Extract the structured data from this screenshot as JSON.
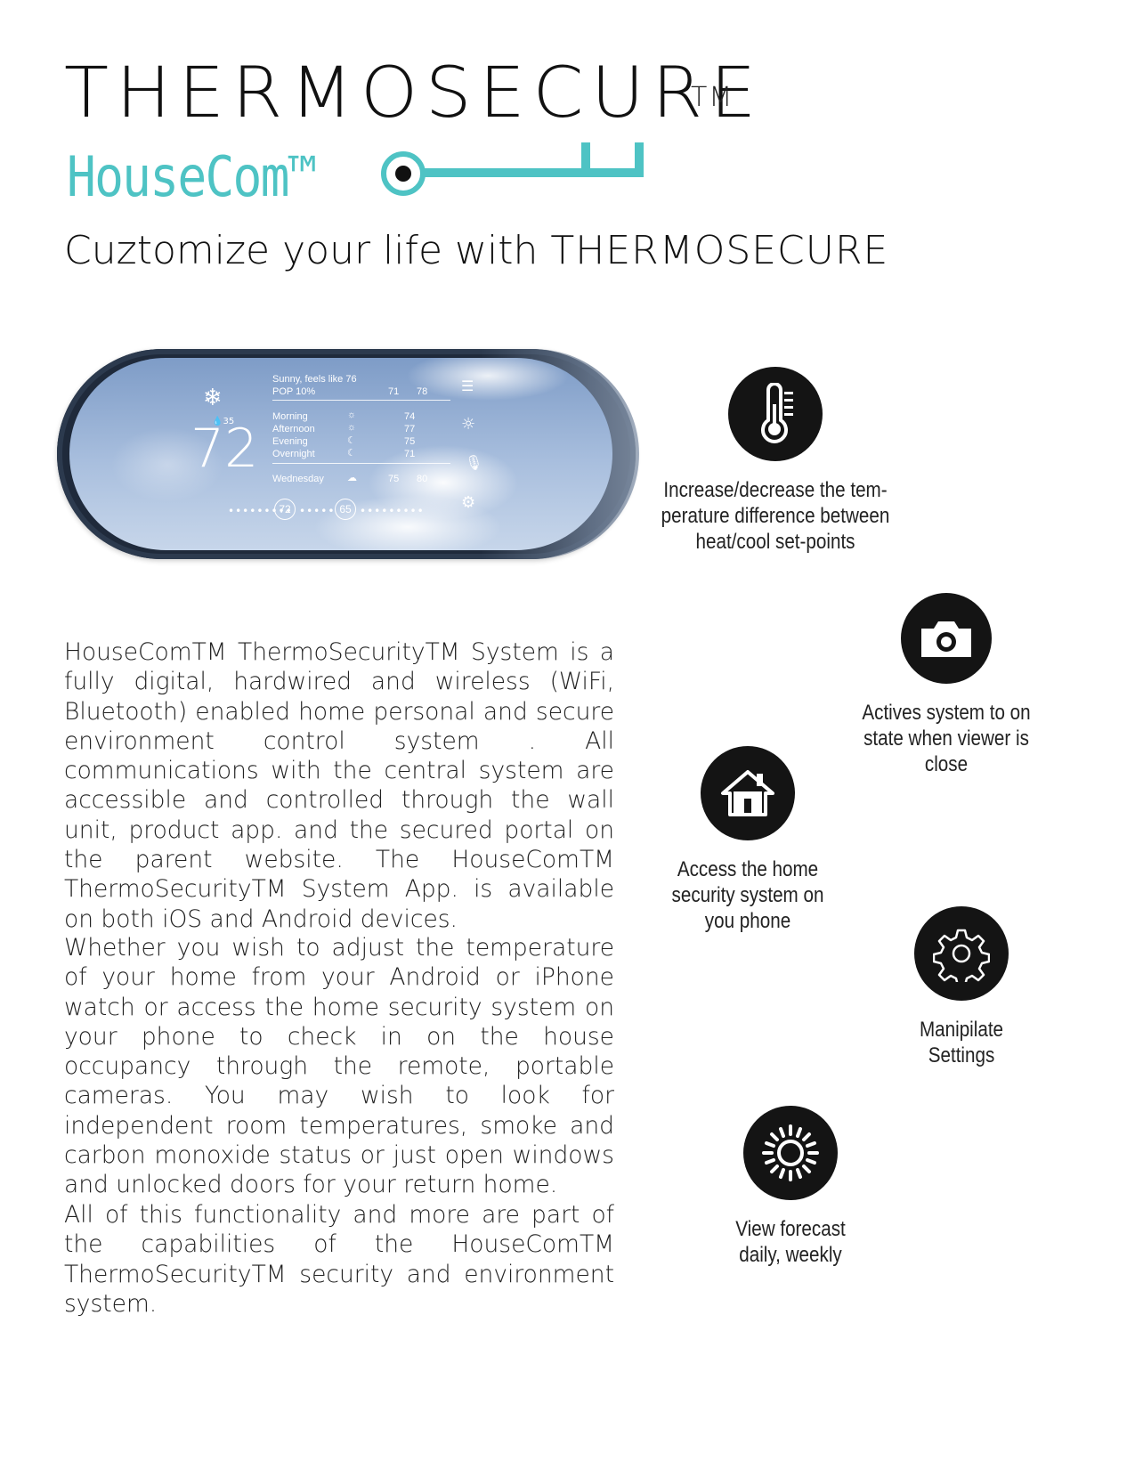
{
  "header": {
    "brand": "THERMOSECURE",
    "brand_tm": "TM",
    "product": "HouseCom™",
    "tagline_prefix": "Cuztomize your life with",
    "tagline_brand": "THERMOSECURE",
    "accent_color": "#4ec3c4"
  },
  "thermostat": {
    "current_temp": "72",
    "humidity": "35",
    "condition": "Sunny, feels like 76",
    "pop": "POP 10%",
    "today_low": "71",
    "today_high": "78",
    "periods": [
      {
        "name": "Morning",
        "temp": "74",
        "icon": "sun-icon"
      },
      {
        "name": "Afternoon",
        "temp": "77",
        "icon": "sun-icon"
      },
      {
        "name": "Evening",
        "temp": "75",
        "icon": "moon-icon"
      },
      {
        "name": "Overnight",
        "temp": "71",
        "icon": "moon-icon"
      }
    ],
    "next_day": {
      "name": "Wednesday",
      "low": "75",
      "high": "80",
      "icon": "cloud-icon"
    },
    "heat_setpoint": "72",
    "cool_setpoint": "65"
  },
  "body": {
    "paragraphs": [
      "HouseComTM ThermoSecurityTM System is a fully digital, hardwired and wireless (WiFi, Blue­tooth) enabled home personal and secure envi­ronment control system . All communications with the central system are accessible and con­trolled through the wall unit, product app. and the secured portal on the parent website. The HouseComTM ThermoSecurityTM System App. is available on both iOS and Android devices.",
      "Whether you wish to adjust the temperature of your home from your Android or iPhone watch or access the home security system on your phone to check in on the house occupancy through the remote, portable cameras. You may wish to look for independent room temperatures, smoke and carbon monoxide status or just open windows and unlocked doors for your return home.",
      "All of this functionality and more are part of the capabilities of the HouseComTM ThermoSecuri­tyTM security and environment system."
    ]
  },
  "features": [
    {
      "icon": "thermometer-icon",
      "label": "Increase/decrease the tem-\nperature difference between\nheat/cool set-points"
    },
    {
      "icon": "camera-icon",
      "label": "Actives system to on\nstate when viewer is\nclose"
    },
    {
      "icon": "home-icon",
      "label": "Access the home\nsecurity system on\nyou phone"
    },
    {
      "icon": "gear-icon",
      "label": "Manipilate\nSettings"
    },
    {
      "icon": "sun-icon",
      "label": "View forecast\ndaily, weekly"
    }
  ]
}
